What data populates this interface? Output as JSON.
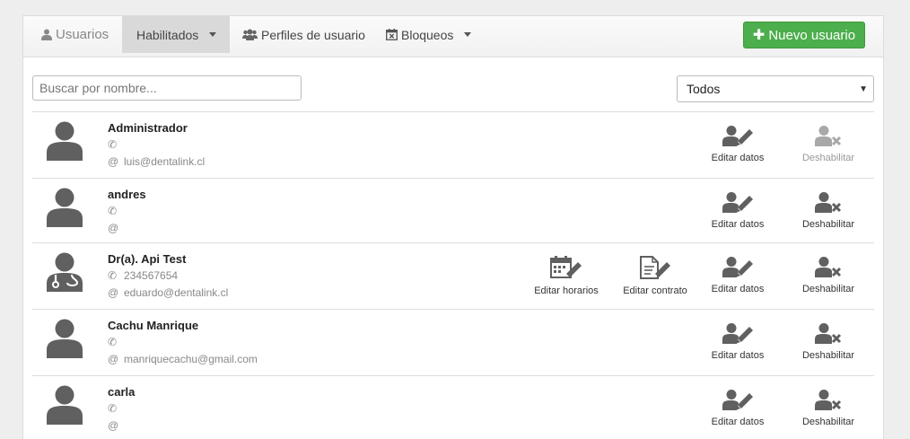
{
  "tabs": {
    "usuarios": "Usuarios",
    "habilitados": "Habilitados",
    "perfiles": "Perfiles de usuario",
    "bloqueos": "Bloqueos"
  },
  "new_user_button": "Nuevo usuario",
  "search": {
    "placeholder": "Buscar por nombre..."
  },
  "filter": {
    "selected": "Todos"
  },
  "action_labels": {
    "editar_horarios": "Editar horarios",
    "editar_contrato": "Editar contrato",
    "editar_datos": "Editar datos",
    "deshabilitar": "Deshabilitar"
  },
  "users": [
    {
      "name": "Administrador",
      "phone": "",
      "email": "luis@dentalink.cl",
      "role": "user",
      "deshabilitar_enabled": false
    },
    {
      "name": "andres",
      "phone": "",
      "email": "",
      "role": "user",
      "deshabilitar_enabled": true
    },
    {
      "name": "Dr(a). Api Test",
      "phone": "234567654",
      "email": "eduardo@dentalink.cl",
      "role": "doctor",
      "deshabilitar_enabled": true
    },
    {
      "name": "Cachu Manrique",
      "phone": "",
      "email": "manriquecachu@gmail.com",
      "role": "user",
      "deshabilitar_enabled": true
    },
    {
      "name": "carla",
      "phone": "",
      "email": "",
      "role": "user",
      "deshabilitar_enabled": true
    }
  ],
  "colors": {
    "accent_green": "#4cae4c",
    "icon_gray": "#606060",
    "disabled_gray": "#a8a8a8"
  }
}
